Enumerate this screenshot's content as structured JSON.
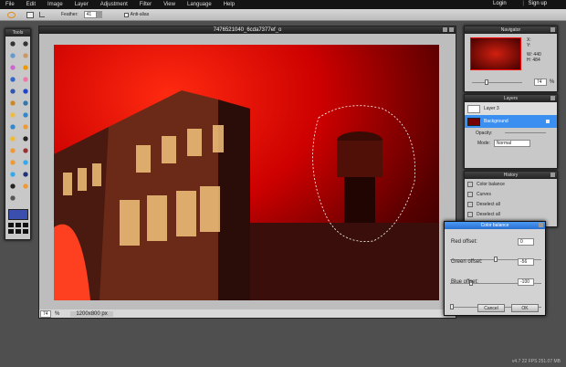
{
  "menu": [
    "File",
    "Edit",
    "Image",
    "Layer",
    "Adjustment",
    "Filter",
    "View",
    "Language",
    "Help"
  ],
  "auth": {
    "login": "Login",
    "signup": "Sign up",
    "sep": "|"
  },
  "toolbar": {
    "feather_label": "Feather:",
    "feather_value": "41",
    "antialias_label": "Anti-alias"
  },
  "tools": {
    "title": "Tools",
    "primary_color": "#3a4fae"
  },
  "document": {
    "title": "7476521040_6cda7377ef_o",
    "zoom": "74",
    "zoom_unit": "%",
    "size": "1200x800 px"
  },
  "navigator": {
    "title": "Navigator",
    "x_label": "X:",
    "y_label": "Y:",
    "w_label": "W:",
    "h_label": "H:",
    "w_value": "440",
    "h_value": "484",
    "zoom": "74",
    "zoom_unit": "%"
  },
  "layers": {
    "title": "Layers",
    "items": [
      {
        "name": "Layer 3",
        "selected": false
      },
      {
        "name": "Background",
        "selected": true
      }
    ],
    "opacity_label": "Opacity:",
    "mode_label": "Mode:",
    "mode_value": "Normal"
  },
  "history": {
    "title": "History",
    "items": [
      "Color balance",
      "Curves",
      "Deselect all",
      "Deselect all"
    ]
  },
  "color_balance": {
    "title": "Color balance",
    "red_label": "Red offset:",
    "red_value": "0",
    "green_label": "Green offset:",
    "green_value": "-56",
    "blue_label": "Blue offset:",
    "blue_value": "-100",
    "cancel": "Cancel",
    "ok": "OK"
  },
  "footer": "v4.7  22 FPS 251.07 MB",
  "colors": {
    "accent": "#3b8ff0",
    "menubar": "#141414"
  }
}
